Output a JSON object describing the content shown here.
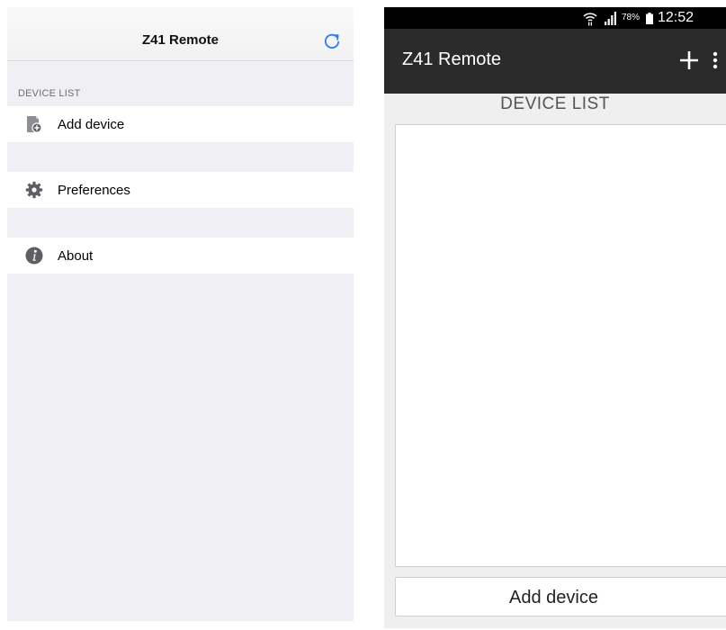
{
  "ios": {
    "nav_title": "Z41 Remote",
    "refresh_icon": "refresh-icon",
    "section_header": "DEVICE LIST",
    "cells": {
      "add_device": {
        "label": "Add device",
        "icon": "add-device-icon"
      },
      "preferences": {
        "label": "Preferences",
        "icon": "gear-icon"
      },
      "about": {
        "label": "About",
        "icon": "info-icon"
      }
    },
    "colors": {
      "accent": "#2f7cf6",
      "background": "#efeff4",
      "icon_gray": "#5f5f63"
    }
  },
  "android": {
    "status_bar": {
      "battery_percent": "78%",
      "clock": "12:52",
      "icons": [
        "wifi-icon",
        "signal-icon",
        "battery-icon"
      ]
    },
    "action_bar": {
      "title": "Z41 Remote",
      "add_icon": "plus-icon",
      "menu_icon": "overflow-menu-icon"
    },
    "list_title": "DEVICE LIST",
    "add_button_label": "Add device",
    "colors": {
      "action_bar": "#2b2b2b",
      "status_bar": "#000000",
      "background": "#efefef"
    }
  }
}
